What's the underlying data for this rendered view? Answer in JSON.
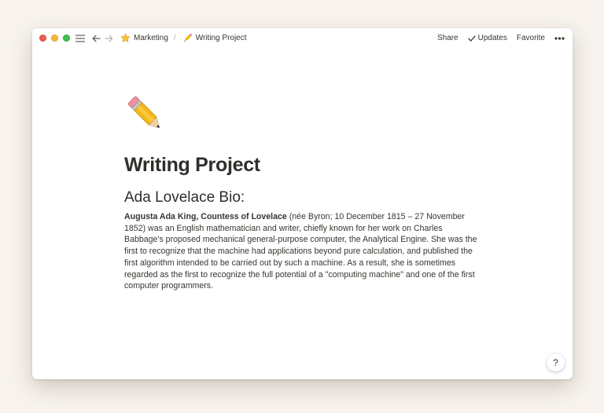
{
  "titlebar": {
    "breadcrumbs": [
      {
        "icon": "star-icon",
        "label": "Marketing"
      },
      {
        "icon": "pencil-icon",
        "label": "Writing Project"
      }
    ],
    "separator": "/",
    "share_label": "Share",
    "updates_label": "Updates",
    "favorite_label": "Favorite"
  },
  "page": {
    "icon": "pencil-icon",
    "title": "Writing Project",
    "heading": "Ada Lovelace Bio:",
    "paragraph": {
      "bold_lead": "Augusta Ada King, Countess of Lovelace",
      "text": " (née Byron; 10 December 1815 – 27 November 1852) was an English mathematician and writer, chiefly known for her work on Charles Babbage's proposed mechanical general-purpose computer, the Analytical Engine. She was the first to recognize that the machine had applications beyond pure calculation, and published the first algorithm intended to be carried out by such a machine. As a result, she is sometimes regarded as the first to recognize the full potential of a \"computing machine\" and one of the first computer programmers."
    }
  },
  "help": {
    "label": "?"
  },
  "colors": {
    "background": "#f8f3ee",
    "window": "#ffffff",
    "text": "#37352f",
    "close": "#ee5c54",
    "minimize": "#f4b93a",
    "maximize": "#3fc24d"
  }
}
